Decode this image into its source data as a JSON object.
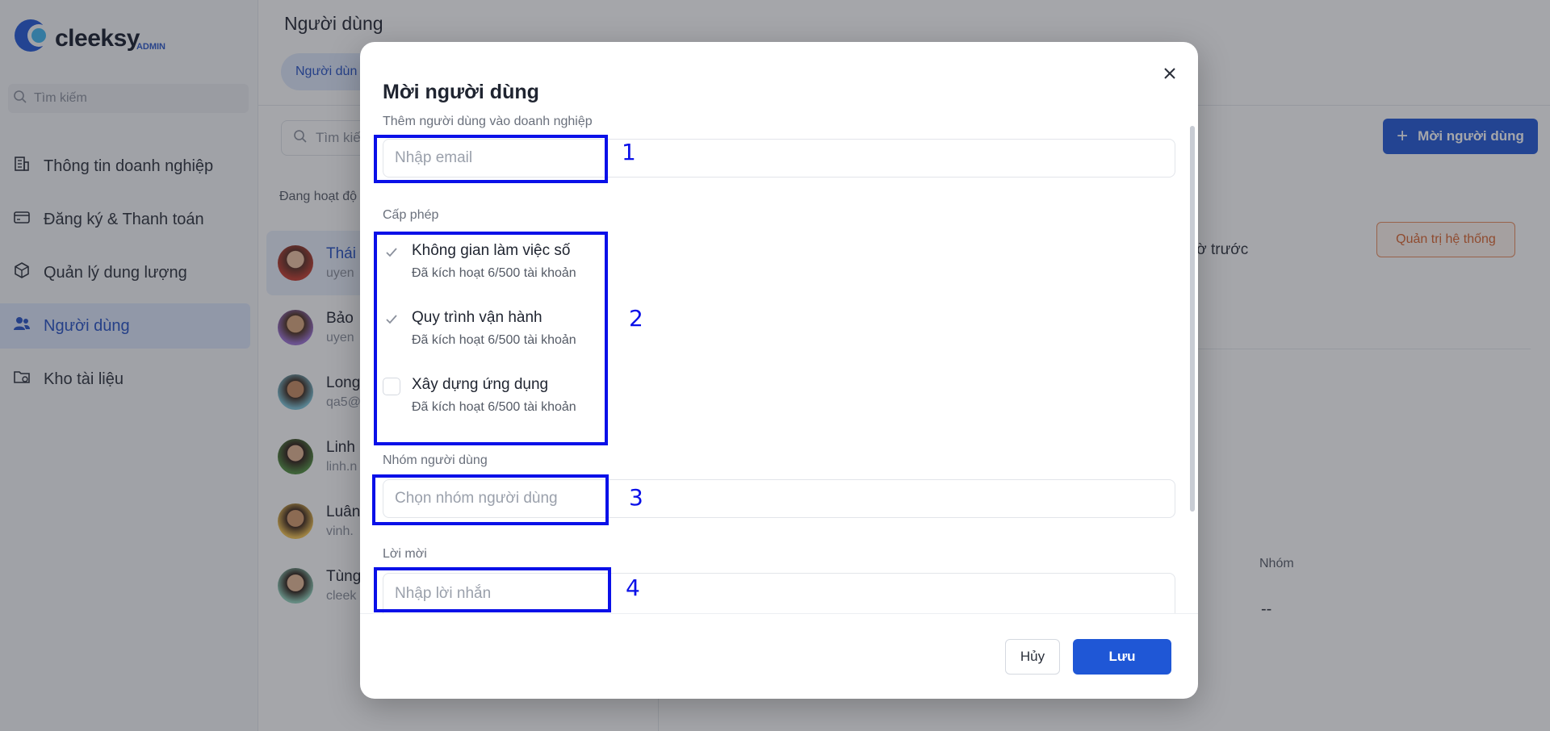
{
  "app": {
    "logo_text": "cleeksy",
    "logo_badge": "ADMIN",
    "brand_color": "#1f57d6"
  },
  "sidebar": {
    "search_placeholder": "Tìm kiếm",
    "items": [
      {
        "label": "Thông tin doanh nghiệp",
        "icon": "building-icon",
        "active": false
      },
      {
        "label": "Đăng ký & Thanh toán",
        "icon": "credit-card-icon",
        "active": false
      },
      {
        "label": "Quản lý dung lượng",
        "icon": "box-icon",
        "active": false
      },
      {
        "label": "Người dùng",
        "icon": "users-icon",
        "active": true
      },
      {
        "label": "Kho tài liệu",
        "icon": "folder-cloud-icon",
        "active": false
      }
    ]
  },
  "main": {
    "page_title": "Người dùng",
    "tab_label": "Người dùn",
    "list_search_placeholder": "Tìm kiế",
    "status_label": "Đang hoạt độ",
    "users": [
      {
        "name": "Thái",
        "sub": "uyen",
        "selected": true
      },
      {
        "name": "Bảo",
        "sub": "uyen",
        "selected": false
      },
      {
        "name": "Long",
        "sub": "qa5@",
        "selected": false
      },
      {
        "name": "Linh",
        "sub": "linh.n",
        "selected": false
      },
      {
        "name": "Luân",
        "sub": "vinh.",
        "selected": false
      },
      {
        "name": "Tùng",
        "sub": "cleek",
        "selected": false
      }
    ],
    "invite_button": "Mời người dùng",
    "role_button": "Quản trị hệ thống",
    "last_active_text": "iờ trước",
    "group_column_header": "Nhóm",
    "group_value": "--"
  },
  "modal": {
    "title": "Mời người dùng",
    "email_section_label": "Thêm người dùng vào doanh nghiệp",
    "email_placeholder": "Nhập email",
    "license_section_label": "Cấp phép",
    "licenses": [
      {
        "title": "Không gian làm việc số",
        "sub": "Đã kích hoạt 6/500 tài khoản",
        "checked": true
      },
      {
        "title": "Quy trình vận hành",
        "sub": "Đã kích hoạt 6/500 tài khoản",
        "checked": true
      },
      {
        "title": "Xây dựng ứng dụng",
        "sub": "Đã kích hoạt 6/500 tài khoản",
        "checked": false
      }
    ],
    "group_section_label": "Nhóm người dùng",
    "group_placeholder": "Chọn nhóm người dùng",
    "message_section_label": "Lời mời",
    "message_placeholder": "Nhập lời nhắn",
    "cancel_label": "Hủy",
    "save_label": "Lưu"
  },
  "annotations": {
    "color": "#0a10e8",
    "labels": [
      "1",
      "2",
      "3",
      "4"
    ]
  }
}
